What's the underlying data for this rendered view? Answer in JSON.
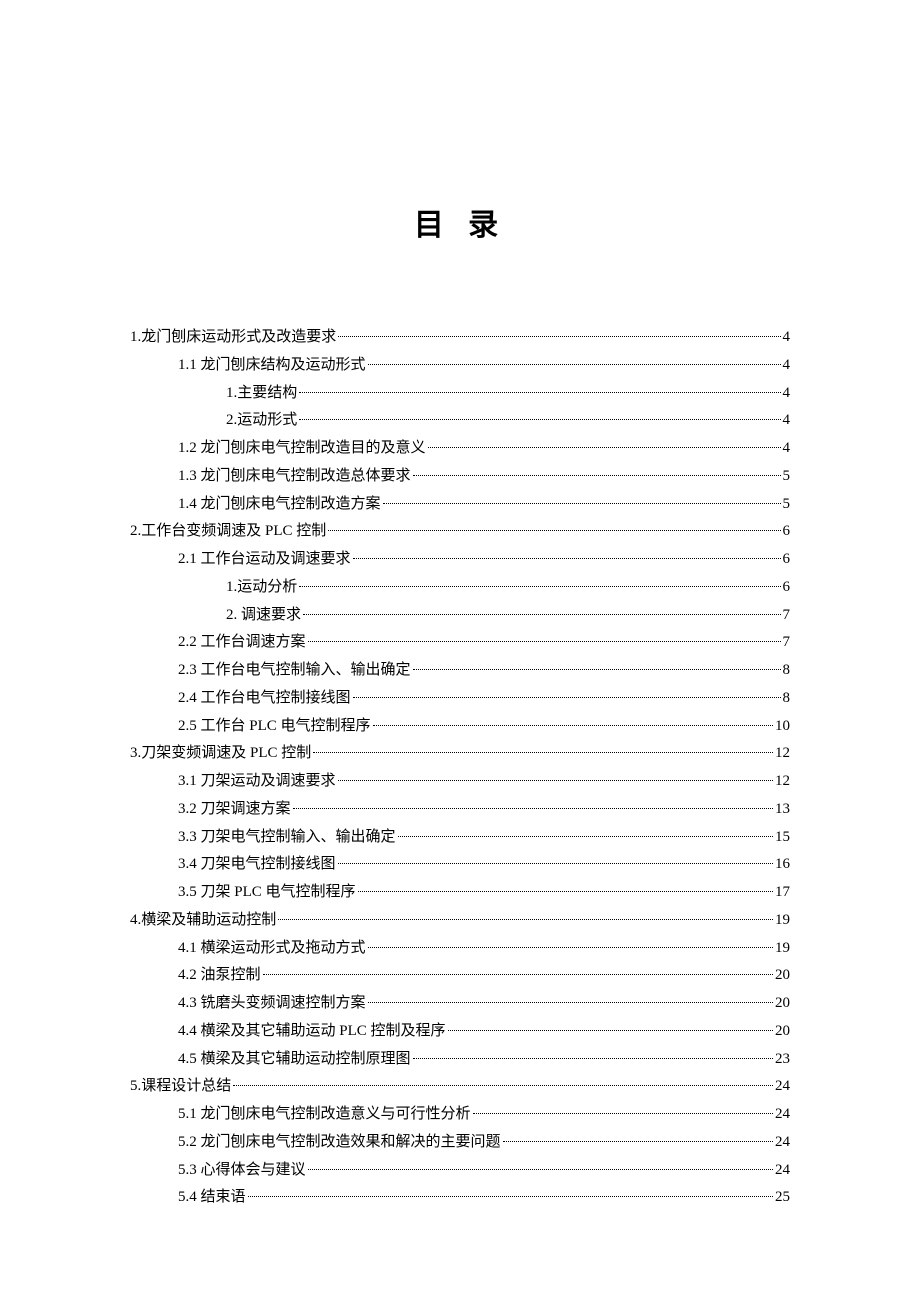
{
  "title": "目 录",
  "toc": [
    {
      "level": 0,
      "text": "1.龙门刨床运动形式及改造要求",
      "page": "4"
    },
    {
      "level": 1,
      "text": "1.1 龙门刨床结构及运动形式",
      "page": "4"
    },
    {
      "level": 2,
      "text": "1.主要结构",
      "page": "4"
    },
    {
      "level": 2,
      "text": "2.运动形式",
      "page": "4"
    },
    {
      "level": 1,
      "text": "1.2 龙门刨床电气控制改造目的及意义",
      "page": "4"
    },
    {
      "level": 1,
      "text": "1.3 龙门刨床电气控制改造总体要求",
      "page": "5"
    },
    {
      "level": 1,
      "text": "1.4 龙门刨床电气控制改造方案",
      "page": "5"
    },
    {
      "level": 0,
      "text": "2.工作台变频调速及 PLC 控制 ",
      "page": "6"
    },
    {
      "level": 1,
      "text": "2.1 工作台运动及调速要求",
      "page": "6"
    },
    {
      "level": 2,
      "text": "1.运动分析",
      "page": "6"
    },
    {
      "level": 2,
      "text": "2. 调速要求",
      "page": "7"
    },
    {
      "level": 1,
      "text": "2.2 工作台调速方案",
      "page": "7"
    },
    {
      "level": 1,
      "text": "2.3 工作台电气控制输入、输出确定",
      "page": "8"
    },
    {
      "level": 1,
      "text": "2.4 工作台电气控制接线图",
      "page": "8"
    },
    {
      "level": 1,
      "text": "2.5 工作台 PLC 电气控制程序 ",
      "page": "10"
    },
    {
      "level": 0,
      "text": "3.刀架变频调速及 PLC 控制 ",
      "page": "12"
    },
    {
      "level": 1,
      "text": "3.1 刀架运动及调速要求",
      "page": "12"
    },
    {
      "level": 1,
      "text": "3.2 刀架调速方案",
      "page": "13"
    },
    {
      "level": 1,
      "text": "3.3 刀架电气控制输入、输出确定",
      "page": "15"
    },
    {
      "level": 1,
      "text": "3.4 刀架电气控制接线图",
      "page": "16"
    },
    {
      "level": 1,
      "text": "3.5 刀架 PLC 电气控制程序 ",
      "page": "17"
    },
    {
      "level": 0,
      "text": "4.横梁及辅助运动控制",
      "page": "19"
    },
    {
      "level": 1,
      "text": "4.1 横梁运动形式及拖动方式",
      "page": "19"
    },
    {
      "level": 1,
      "text": "4.2 油泵控制",
      "page": "20"
    },
    {
      "level": 1,
      "text": "4.3 铣磨头变频调速控制方案",
      "page": "20"
    },
    {
      "level": 1,
      "text": "4.4 横梁及其它辅助运动 PLC 控制及程序 ",
      "page": "20"
    },
    {
      "level": 1,
      "text": "4.5 横梁及其它辅助运动控制原理图",
      "page": "23"
    },
    {
      "level": 0,
      "text": "5.课程设计总结",
      "page": "24"
    },
    {
      "level": 1,
      "text": "5.1 龙门刨床电气控制改造意义与可行性分析",
      "page": "24"
    },
    {
      "level": 1,
      "text": "5.2 龙门刨床电气控制改造效果和解决的主要问题",
      "page": "24"
    },
    {
      "level": 1,
      "text": "5.3 心得体会与建议",
      "page": "24"
    },
    {
      "level": 1,
      "text": "5.4 结束语",
      "page": "25"
    }
  ]
}
